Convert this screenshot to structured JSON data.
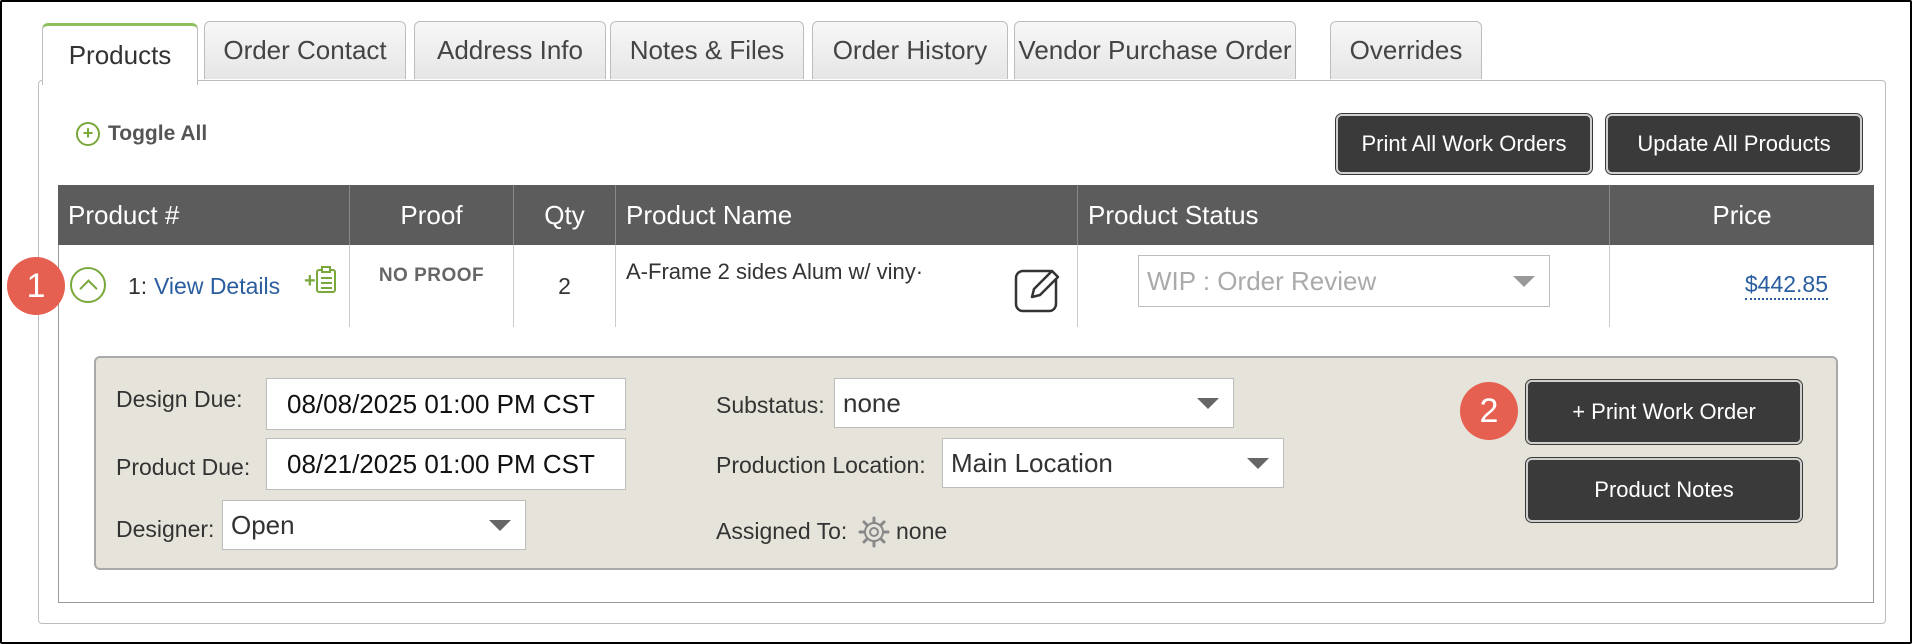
{
  "tabs": [
    "Products",
    "Order Contact",
    "Address Info",
    "Notes & Files",
    "Order History",
    "Vendor Purchase Order",
    "Overrides"
  ],
  "toolbar": {
    "toggle_all": "Toggle All",
    "print_all": "Print All Work Orders",
    "update_all": "Update All Products"
  },
  "table": {
    "headers": [
      "Product #",
      "Proof",
      "Qty",
      "Product Name",
      "Product Status",
      "Price"
    ],
    "row": {
      "number": "1:",
      "view_details": "View Details",
      "proof": "NO PROOF",
      "qty": "2",
      "product_name": "A-Frame 2 sides Alum w/ viny·",
      "status": "WIP : Order Review",
      "price": "$442.85"
    }
  },
  "details": {
    "design_due_label": "Design Due:",
    "design_due": "08/08/2025 01:00 PM CST",
    "product_due_label": "Product Due:",
    "product_due": "08/21/2025 01:00 PM CST",
    "designer_label": "Designer:",
    "designer": "Open",
    "substatus_label": "Substatus:",
    "substatus": "none",
    "location_label": "Production Location:",
    "location": "Main Location",
    "assigned_label": "Assigned To:",
    "assigned": "none",
    "print_work_order": "+ Print Work Order",
    "product_notes": "Product Notes"
  },
  "badges": [
    "1",
    "2"
  ],
  "colors": {
    "accent_green": "#7aa83c",
    "badge_red": "#e66051",
    "header_gray": "#5c5c5c",
    "button_dark": "#3a3a3a"
  }
}
